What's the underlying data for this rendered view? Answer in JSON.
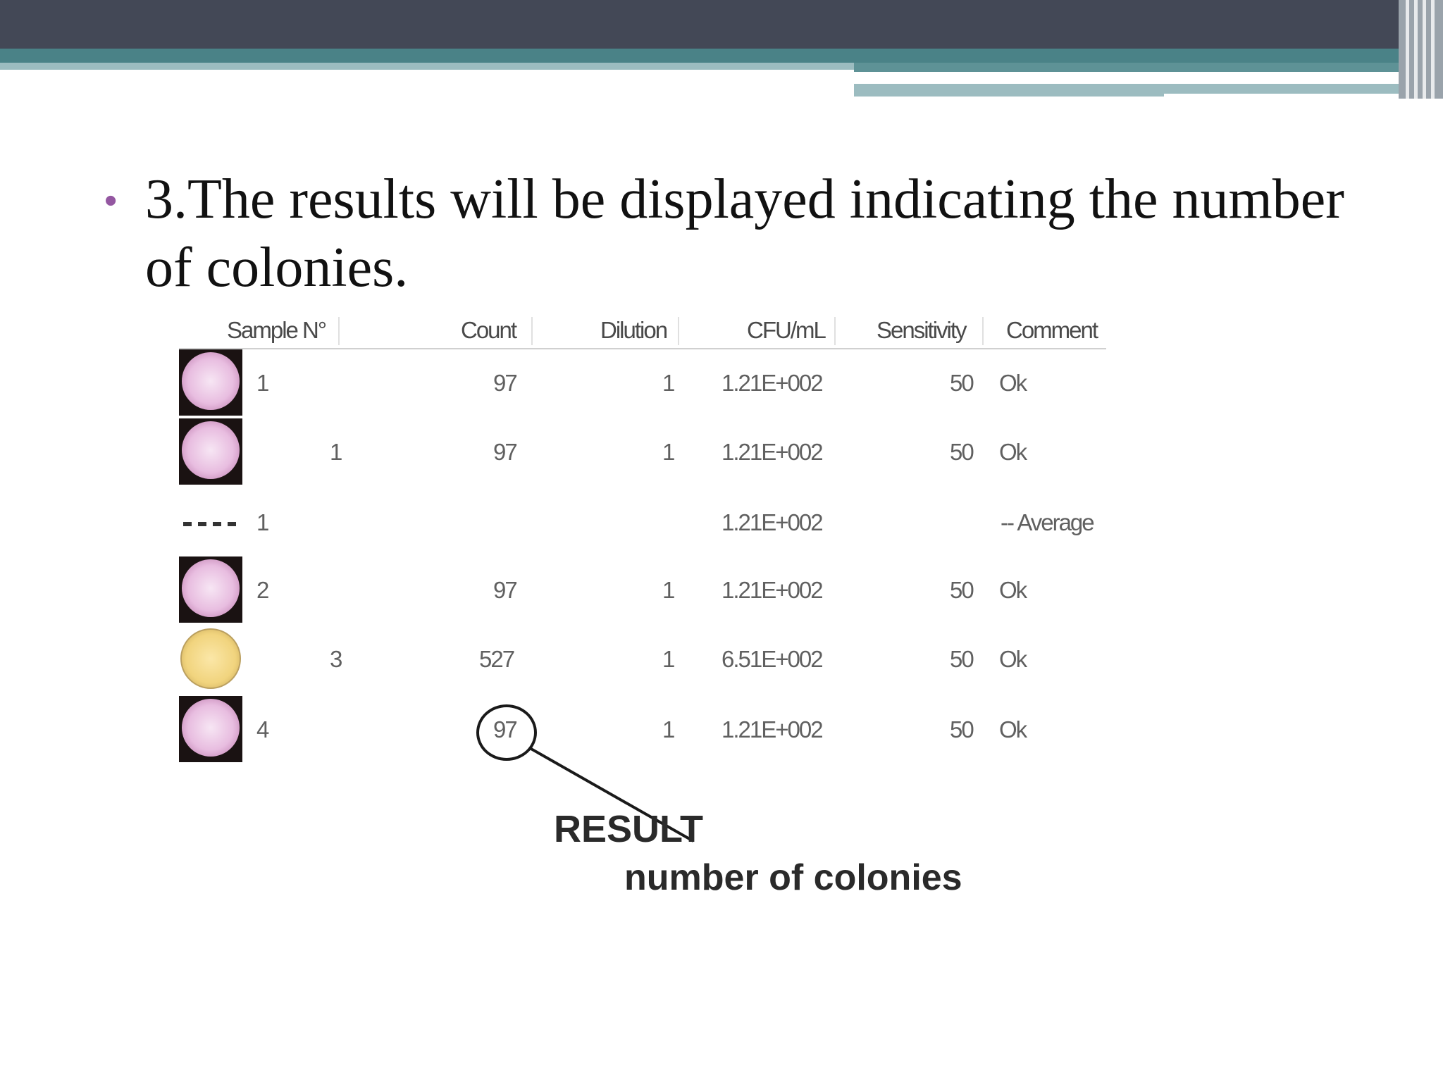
{
  "slide": {
    "bullet_text": "3.The results will be displayed indicating the number of colonies."
  },
  "table": {
    "headers": {
      "sample": "Sample N°",
      "count": "Count",
      "dilution": "Dilution",
      "cfu": "CFU/mL",
      "sensitivity": "Sensitivity",
      "comment": "Comment"
    },
    "rows": [
      {
        "thumb": "pink-plate",
        "sample": "1",
        "sub": "",
        "count": "97",
        "dilution": "1",
        "cfu": "1.21E+002",
        "sensitivity": "50",
        "comment": "Ok"
      },
      {
        "thumb": "pink-plate",
        "sample": "",
        "sub": "1",
        "count": "97",
        "dilution": "1",
        "cfu": "1.21E+002",
        "sensitivity": "50",
        "comment": "Ok"
      },
      {
        "thumb": "dashed-line",
        "sample": "1",
        "sub": "",
        "count": "",
        "dilution": "",
        "cfu": "1.21E+002",
        "sensitivity": "",
        "comment": "-- Average"
      },
      {
        "thumb": "pink-plate",
        "sample": "2",
        "sub": "",
        "count": "97",
        "dilution": "1",
        "cfu": "1.21E+002",
        "sensitivity": "50",
        "comment": "Ok"
      },
      {
        "thumb": "yellow-plate",
        "sample": "",
        "sub": "3",
        "count": "527",
        "dilution": "1",
        "cfu": "6.51E+002",
        "sensitivity": "50",
        "comment": "Ok"
      },
      {
        "thumb": "pink-plate",
        "sample": "4",
        "sub": "",
        "count": "97",
        "dilution": "1",
        "cfu": "1.21E+002",
        "sensitivity": "50",
        "comment": "Ok"
      }
    ]
  },
  "callout": {
    "title": "RESULT",
    "subtitle": "number of colonies"
  },
  "colors": {
    "header_bar": "#434856",
    "accent_teal": "#4a8287",
    "bullet": "#9457a1"
  }
}
